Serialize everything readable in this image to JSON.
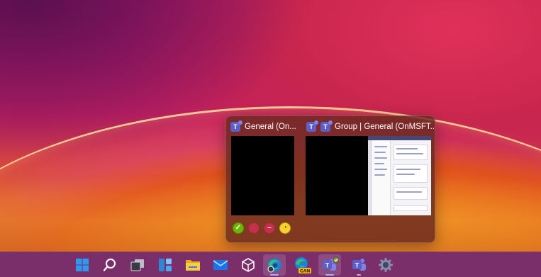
{
  "preview": {
    "windows": [
      {
        "title": "General (On...",
        "app_icon": "teams-icon"
      },
      {
        "title": "Group | General (OnMSFT...",
        "app_icon": "teams-icon"
      }
    ],
    "status_buttons": [
      {
        "name": "available",
        "icon": "check-icon",
        "color": "#6bb700",
        "glyph": "✓"
      },
      {
        "name": "busy",
        "icon": "busy-icon",
        "color": "#c4314b",
        "glyph": ""
      },
      {
        "name": "do-not-disturb",
        "icon": "minus-icon",
        "color": "#c4314b",
        "glyph": "–"
      },
      {
        "name": "away",
        "icon": "clock-icon",
        "color": "#f8d22a",
        "glyph": "◔"
      }
    ]
  },
  "taskbar": {
    "items": [
      {
        "name": "start",
        "icon": "windows-logo-icon"
      },
      {
        "name": "search",
        "icon": "search-icon"
      },
      {
        "name": "task-view",
        "icon": "task-view-icon"
      },
      {
        "name": "widgets",
        "icon": "widgets-icon"
      },
      {
        "name": "file-explorer",
        "icon": "folder-icon"
      },
      {
        "name": "mail",
        "icon": "mail-icon"
      },
      {
        "name": "app-3d",
        "icon": "cube-icon"
      },
      {
        "name": "edge-beta",
        "icon": "edge-beta-icon"
      },
      {
        "name": "edge-canary",
        "icon": "edge-canary-icon",
        "badge": "CAN"
      },
      {
        "name": "teams-work",
        "icon": "teams-icon"
      },
      {
        "name": "teams-personal",
        "icon": "teams-icon"
      },
      {
        "name": "settings",
        "icon": "gear-icon"
      }
    ],
    "colors": {
      "accent": "#9fb6ff",
      "teams": "#5b5fc7",
      "windows_blue": "#2b9af3"
    }
  }
}
